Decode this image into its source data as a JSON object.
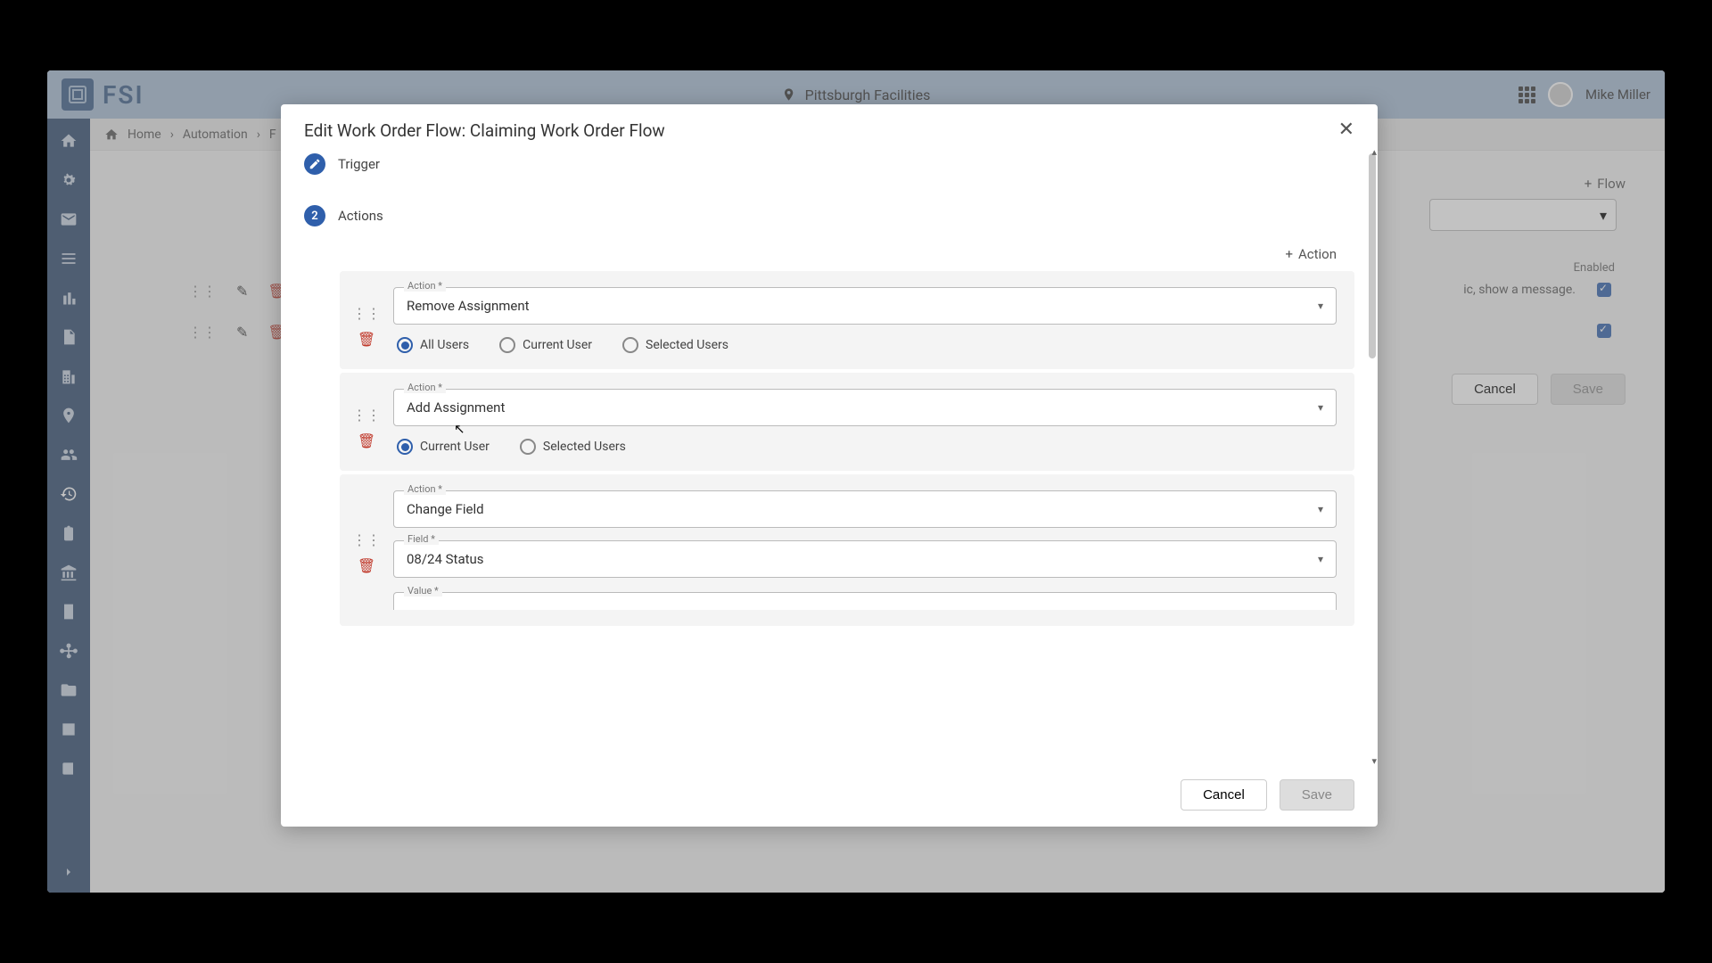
{
  "topbar": {
    "brand": "FSI",
    "location": "Pittsburgh Facilities",
    "user_name": "Mike Miller"
  },
  "breadcrumb": {
    "items": [
      "Home",
      "Automation",
      "F"
    ]
  },
  "background": {
    "add_flow_label": "Flow",
    "enabled_header": "Enabled",
    "row1_text": "ic, show a message.",
    "cancel": "Cancel",
    "save": "Save"
  },
  "modal": {
    "title": "Edit Work Order Flow: Claiming Work Order Flow",
    "step1_label": "Trigger",
    "step2_label": "Actions",
    "add_action_label": "Action",
    "cancel": "Cancel",
    "save": "Save",
    "action_field_label": "Action *",
    "field_field_label": "Field *",
    "value_field_label": "Value *",
    "actions": [
      {
        "action_value": "Remove Assignment",
        "radios": [
          "All Users",
          "Current User",
          "Selected Users"
        ],
        "selected_radio": 0
      },
      {
        "action_value": "Add Assignment",
        "radios": [
          "Current User",
          "Selected Users"
        ],
        "selected_radio": 0
      },
      {
        "action_value": "Change Field",
        "field_value": "08/24 Status"
      }
    ]
  }
}
